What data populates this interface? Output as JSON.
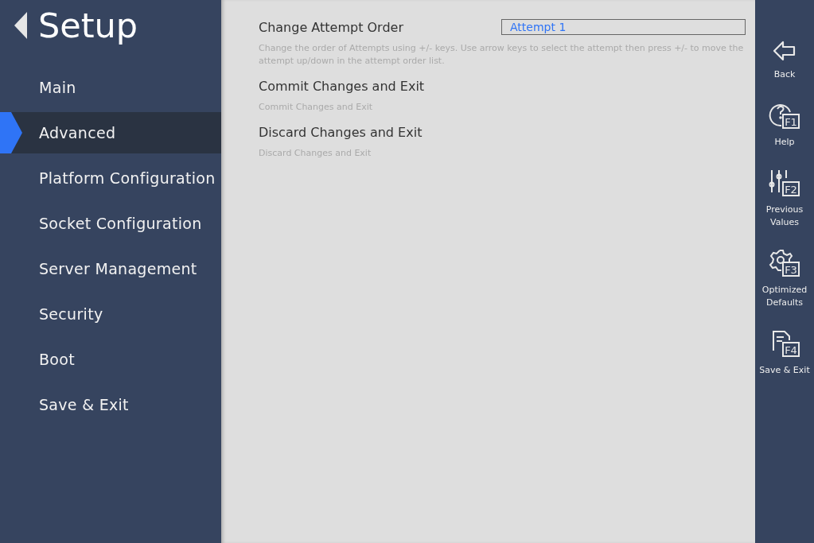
{
  "title": "Setup",
  "menu": [
    {
      "label": "Main",
      "selected": false
    },
    {
      "label": "Advanced",
      "selected": true
    },
    {
      "label": "Platform Configuration",
      "selected": false
    },
    {
      "label": "Socket Configuration",
      "selected": false
    },
    {
      "label": "Server Management",
      "selected": false
    },
    {
      "label": "Security",
      "selected": false
    },
    {
      "label": "Boot",
      "selected": false
    },
    {
      "label": "Save & Exit",
      "selected": false
    }
  ],
  "settings": [
    {
      "label": "Change Attempt Order",
      "value": "Attempt 1",
      "help": "Change the order of Attempts using +/- keys. Use arrow keys to select the attempt then press +/- to move the attempt up/down in the attempt order list."
    },
    {
      "label": "Commit Changes and Exit",
      "help": "Commit Changes and Exit"
    },
    {
      "label": "Discard Changes and Exit",
      "help": "Discard Changes and Exit"
    }
  ],
  "actions": [
    {
      "kind": "back",
      "label": "Back"
    },
    {
      "kind": "help",
      "key": "F1",
      "label": "Help"
    },
    {
      "kind": "sliders",
      "key": "F2",
      "label": "Previous Values"
    },
    {
      "kind": "gear",
      "key": "F3",
      "label": "Optimized Defaults"
    },
    {
      "kind": "document",
      "key": "F4",
      "label": "Save & Exit"
    }
  ]
}
